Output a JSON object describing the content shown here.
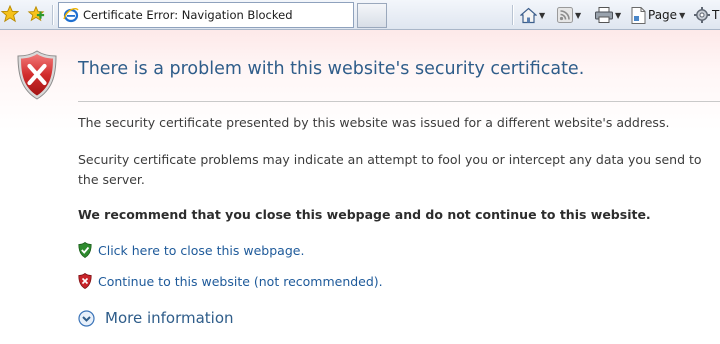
{
  "toolbar": {
    "tab_title": "Certificate Error: Navigation Blocked",
    "page_menu_label": "Page",
    "tools_menu_label": "T"
  },
  "page": {
    "title": "There is a problem with this website's security certificate.",
    "paragraph1": "The security certificate presented by this website was issued for a different website's address.",
    "paragraph2": "Security certificate problems may indicate an attempt to fool you or intercept any data you send to the server.",
    "recommendation": "We recommend that you close this webpage and do not continue to this website.",
    "close_link": "Click here to close this webpage.",
    "continue_link": "Continue to this website (not recommended).",
    "more_info": "More information"
  },
  "colors": {
    "link": "#1e5a9a",
    "title": "#2f5d8a",
    "danger": "#c8242a",
    "safe": "#2e8b2e"
  }
}
